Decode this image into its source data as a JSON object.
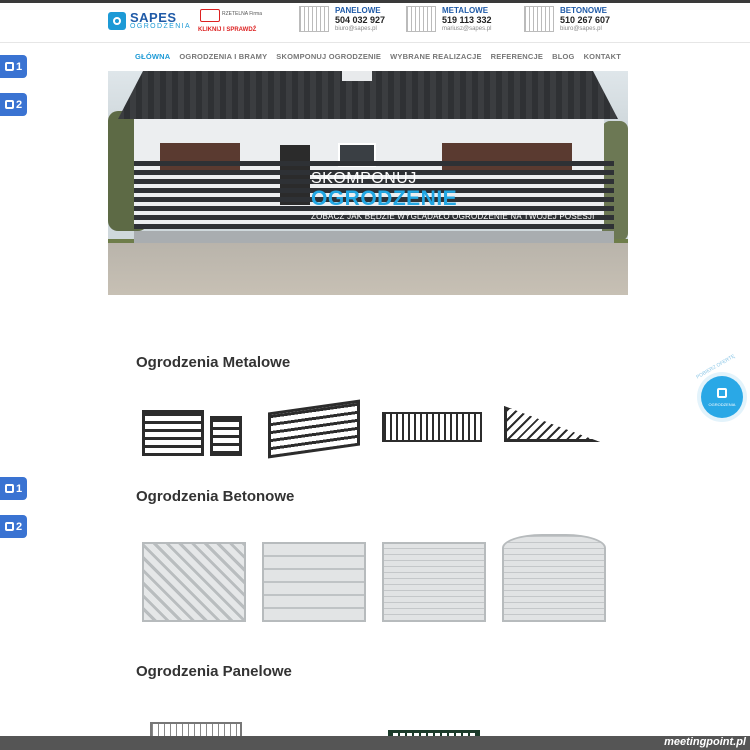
{
  "header": {
    "logo": {
      "brand": "SAPES",
      "sub": "OGRODZENIA"
    },
    "badge": {
      "tiny": "RZETELNA Firma",
      "cta": "KLIKNIJ I SPRAWDŹ"
    },
    "contacts": [
      {
        "title": "PANELOWE",
        "phone": "504 032 927",
        "email": "biuro@sapes.pl"
      },
      {
        "title": "METALOWE",
        "phone": "519 113 332",
        "email": "mariusz@sapes.pl"
      },
      {
        "title": "BETONOWE",
        "phone": "510 267 607",
        "email": "biuro@sapes.pl"
      }
    ]
  },
  "nav": {
    "items": [
      {
        "label": "GŁÓWNA",
        "active": true
      },
      {
        "label": "OGRODZENIA I BRAMY"
      },
      {
        "label": "SKOMPONUJ OGRODZENIE"
      },
      {
        "label": "WYBRANE REALIZACJE"
      },
      {
        "label": "REFERENCJE"
      },
      {
        "label": "BLOG"
      },
      {
        "label": "KONTAKT"
      }
    ]
  },
  "hero": {
    "line1": "SKOMPONUJ",
    "line2": "OGRODZENIE",
    "line3": "ZOBACZ JAK BĘDZIE WYGLĄDAŁO OGRODZENIE NA TWOJEJ POSESJI"
  },
  "side_icons": [
    "1",
    "2",
    "1",
    "2"
  ],
  "floating": {
    "ring_text": "POBIERZ OFERTĘ",
    "label": "OGRODZENIA"
  },
  "sections": {
    "metal": {
      "title": "Ogrodzenia Metalowe"
    },
    "concrete": {
      "title": "Ogrodzenia Betonowe"
    },
    "panel": {
      "title": "Ogrodzenia Panelowe"
    }
  },
  "footer": {
    "watermark": "meetingpoint.pl"
  },
  "colors": {
    "accent": "#22a7e3",
    "brand": "#1f5aa7",
    "side_icon": "#3a73d2",
    "bottom_bar": "#555555"
  }
}
